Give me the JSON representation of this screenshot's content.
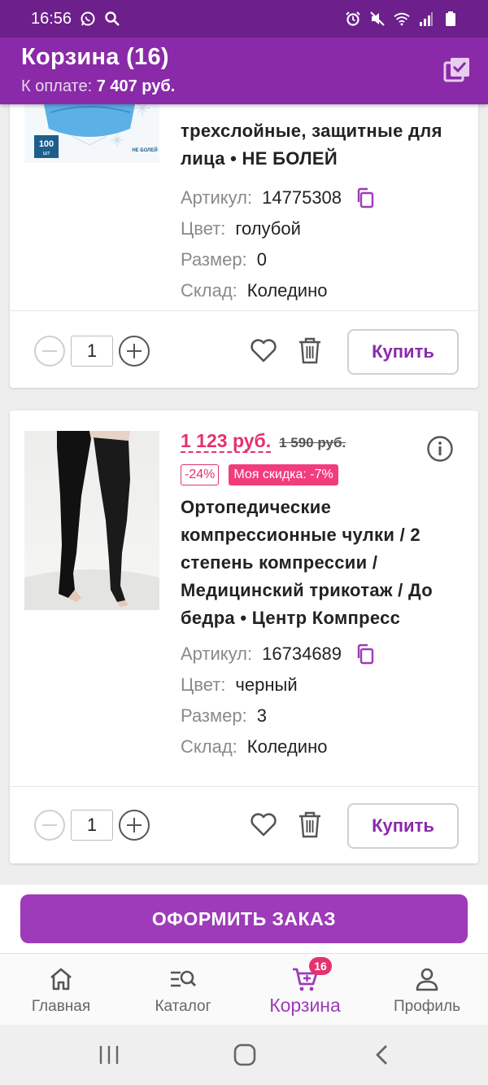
{
  "status_bar": {
    "time": "16:56",
    "icons": [
      "whatsapp-icon",
      "search-icon",
      "alarm-icon",
      "mute-icon",
      "wifi-icon",
      "signal-icon",
      "battery-icon"
    ]
  },
  "header": {
    "title": "Корзина (16)",
    "subtitle_label": "К оплате:",
    "subtitle_amount": "7 407 руб.",
    "select_icon": "checkbox-list-icon"
  },
  "colors": {
    "brand": "#8a2aa8",
    "brand_dark": "#6d1f8c",
    "price": "#e3326e",
    "discount_badge": "#f23c7c"
  },
  "items": [
    {
      "name_partial": "трехслойные, защитные для лица • НЕ БОЛЕЙ",
      "image_text": {
        "count": "100",
        "unit": "шт",
        "brand": "НЕ БОЛЕЙ"
      },
      "article_label": "Артикул:",
      "article": "14775308",
      "color_label": "Цвет:",
      "color": "голубой",
      "size_label": "Размер:",
      "size": "0",
      "warehouse_label": "Склад:",
      "warehouse": "Коледино",
      "quantity": "1",
      "buy_label": "Купить"
    },
    {
      "price": "1 123 руб.",
      "old_price": "1 590 руб.",
      "discount": "-24%",
      "my_discount": "Моя скидка: -7%",
      "name": "Ортопедические компрессионные чулки / 2 степень компрессии / Медицинский трикотаж / До бедра • Центр Компресс",
      "article_label": "Артикул:",
      "article": "16734689",
      "color_label": "Цвет:",
      "color": "черный",
      "size_label": "Размер:",
      "size": "3",
      "warehouse_label": "Склад:",
      "warehouse": "Коледино",
      "quantity": "1",
      "buy_label": "Купить"
    }
  ],
  "checkout_label": "ОФОРМИТЬ ЗАКАЗ",
  "bottom_nav": [
    {
      "label": "Главная",
      "icon": "home-icon"
    },
    {
      "label": "Каталог",
      "icon": "catalog-search-icon"
    },
    {
      "label": "Корзина",
      "icon": "cart-icon",
      "badge": "16",
      "active": true
    },
    {
      "label": "Профиль",
      "icon": "profile-icon"
    }
  ],
  "system_nav": [
    "recent-apps-icon",
    "home-circle-icon",
    "back-icon"
  ]
}
